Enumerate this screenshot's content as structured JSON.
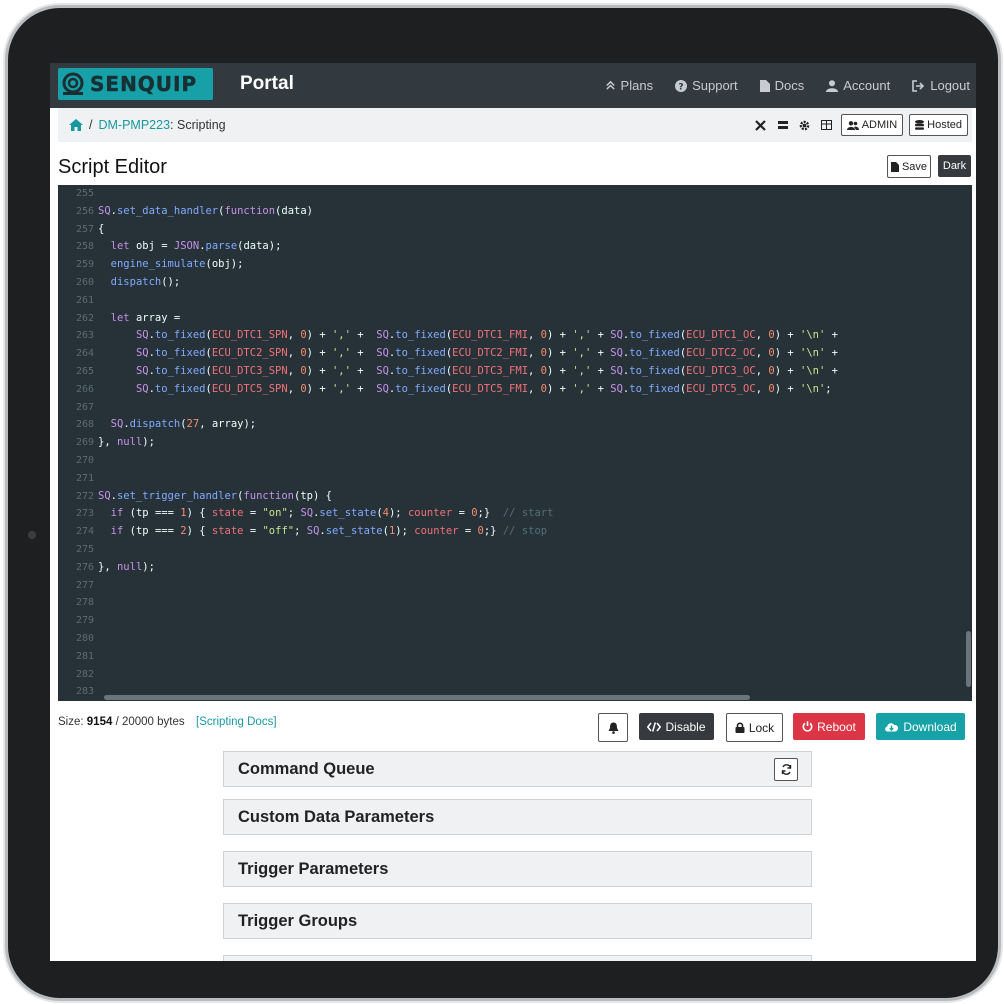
{
  "navbar": {
    "brand": "SENQUIP",
    "portal": "Portal",
    "links": [
      "Plans",
      "Support",
      "Docs",
      "Account",
      "Logout"
    ]
  },
  "breadcrumb": {
    "device": "DM-PMP223",
    "page": ": Scripting",
    "separator": "/",
    "admin_label": "ADMIN",
    "hosted_label": "Hosted"
  },
  "editor_header": {
    "title": "Script Editor",
    "save_label": "Save",
    "dark_label": "Dark"
  },
  "code": {
    "line_numbers": [
      "255",
      "256",
      "257",
      "258",
      "259",
      "260",
      "261",
      "262",
      "263",
      "264",
      "265",
      "266",
      "267",
      "268",
      "269",
      "270",
      "271",
      "272",
      "273",
      "274",
      "275",
      "276",
      "277",
      "278",
      "279",
      "280",
      "281",
      "282",
      "283"
    ],
    "lines": [
      "",
      "SQ.set_data_handler(function(data)",
      "{",
      "  let obj = JSON.parse(data);",
      "  engine_simulate(obj);",
      "  dispatch();",
      "",
      "  let array =",
      "      SQ.to_fixed(ECU_DTC1_SPN, 0) + ',' +  SQ.to_fixed(ECU_DTC1_FMI, 0) + ',' + SQ.to_fixed(ECU_DTC1_OC, 0) + '\\n' +",
      "      SQ.to_fixed(ECU_DTC2_SPN, 0) + ',' +  SQ.to_fixed(ECU_DTC2_FMI, 0) + ',' + SQ.to_fixed(ECU_DTC2_OC, 0) + '\\n' +",
      "      SQ.to_fixed(ECU_DTC3_SPN, 0) + ',' +  SQ.to_fixed(ECU_DTC3_FMI, 0) + ',' + SQ.to_fixed(ECU_DTC3_OC, 0) + '\\n' +",
      "      SQ.to_fixed(ECU_DTC5_SPN, 0) + ',' +  SQ.to_fixed(ECU_DTC5_FMI, 0) + ',' + SQ.to_fixed(ECU_DTC5_OC, 0) + '\\n';",
      "",
      "  SQ.dispatch(27, array);",
      "}, null);",
      "",
      "",
      "SQ.set_trigger_handler(function(tp) {",
      "  if (tp === 1) { state = \"on\"; SQ.set_state(4); counter = 0;}  // start",
      "  if (tp === 2) { state = \"off\"; SQ.set_state(1); counter = 0;} // stop",
      "",
      "}, null);",
      "",
      "",
      "",
      "",
      "",
      "",
      ""
    ]
  },
  "status": {
    "size_label": "Size:",
    "size_value": "9154",
    "size_total": "/ 20000 bytes",
    "docs_link": "[Scripting Docs]"
  },
  "actions": {
    "disable_label": "Disable",
    "lock_label": "Lock",
    "reboot_label": "Reboot",
    "download_label": "Download"
  },
  "panels": [
    "Command Queue",
    "Custom Data Parameters",
    "Trigger Parameters",
    "Trigger Groups"
  ],
  "colors": {
    "navbar": "#32393f",
    "brand": "#17a0a8",
    "editor_bg": "#263238",
    "reboot": "#dc3545",
    "download": "#17a2a8"
  }
}
